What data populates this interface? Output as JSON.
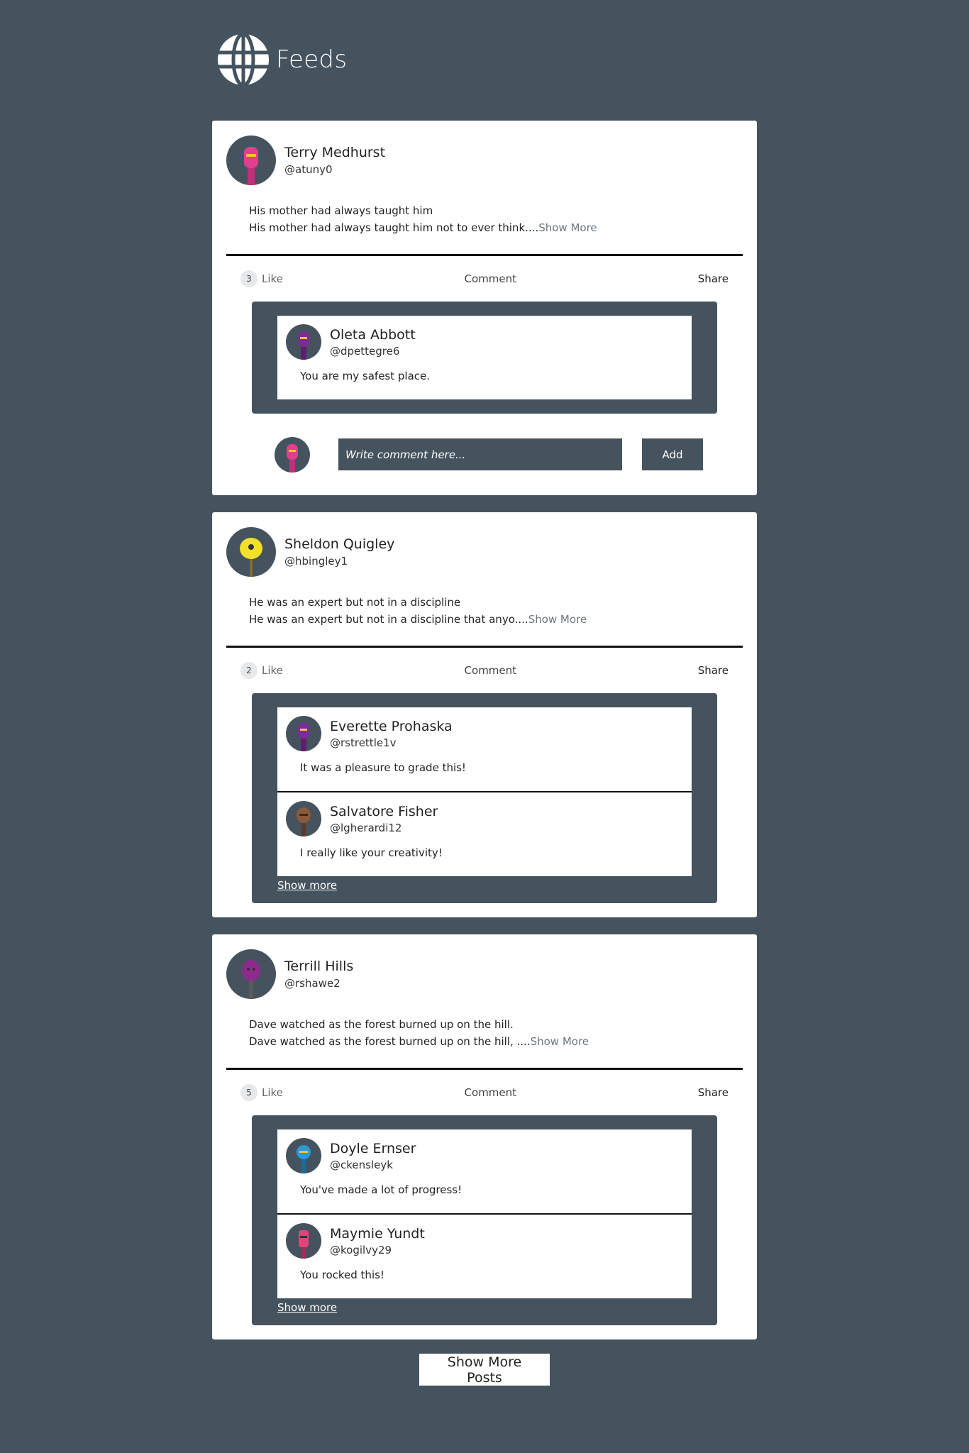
{
  "header": {
    "title": "Feeds",
    "logo_icon": "globe-icon"
  },
  "posts": [
    {
      "author": {
        "name": "Terry Medhurst",
        "handle": "@atuny0",
        "avatar_color": "#e23d8f"
      },
      "title": "His mother had always taught him",
      "excerpt": "His mother had always taught him not to ever think....",
      "show_more": "Show More",
      "likes": "3",
      "like_label": "Like",
      "comment_label": "Comment",
      "share_label": "Share",
      "comments": [
        {
          "name": "Oleta Abbott",
          "handle": "@dpettegre6",
          "body": "You are my safest place.",
          "avatar_color": "#7a2d8f"
        }
      ],
      "add_comment": {
        "placeholder": "Write comment here...",
        "button": "Add"
      }
    },
    {
      "author": {
        "name": "Sheldon Quigley",
        "handle": "@hbingley1",
        "avatar_color": "#f2e02c"
      },
      "title": "He was an expert but not in a discipline",
      "excerpt": "He was an expert but not in a discipline that anyo....",
      "show_more": "Show More",
      "likes": "2",
      "like_label": "Like",
      "comment_label": "Comment",
      "share_label": "Share",
      "comments": [
        {
          "name": "Everette Prohaska",
          "handle": "@rstrettle1v",
          "body": "It was a pleasure to grade this!",
          "avatar_color": "#7e2a9a"
        },
        {
          "name": "Salvatore Fisher",
          "handle": "@lgherardi12",
          "body": "I really like your creativity!",
          "avatar_color": "#8a5a3a"
        }
      ],
      "comments_more": "Show more"
    },
    {
      "author": {
        "name": "Terrill Hills",
        "handle": "@rshawe2",
        "avatar_color": "#8e2a8e"
      },
      "title": "Dave watched as the forest burned up on the hill.",
      "excerpt": "Dave watched as the forest burned up on the hill, ....",
      "show_more": "Show More",
      "likes": "5",
      "like_label": "Like",
      "comment_label": "Comment",
      "share_label": "Share",
      "comments": [
        {
          "name": "Doyle Ernser",
          "handle": "@ckensleyk",
          "body": "You've made a lot of progress!",
          "avatar_color": "#2a9ad8"
        },
        {
          "name": "Maymie Yundt",
          "handle": "@kogilvy29",
          "body": "You rocked this!",
          "avatar_color": "#e2447a"
        }
      ],
      "comments_more": "Show more"
    }
  ],
  "show_more_posts": "Show More Posts"
}
